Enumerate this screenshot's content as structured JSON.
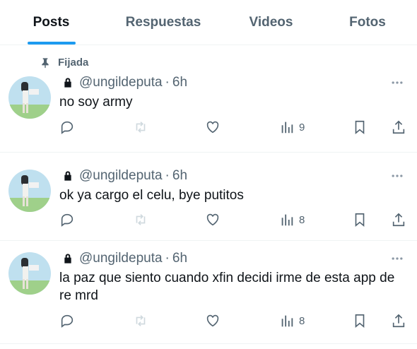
{
  "tabs": [
    {
      "label": "Posts",
      "active": true
    },
    {
      "label": "Respuestas",
      "active": false
    },
    {
      "label": "Videos",
      "active": false
    },
    {
      "label": "Fotos",
      "active": false
    }
  ],
  "pinned_label": "Fijada",
  "posts": [
    {
      "handle": "@ungildeputa",
      "separator": "·",
      "time": "6h",
      "text": "no soy army",
      "views": "9"
    },
    {
      "handle": "@ungildeputa",
      "separator": "·",
      "time": "6h",
      "text": "ok ya cargo el celu, bye putitos",
      "views": "8"
    },
    {
      "handle": "@ungildeputa",
      "separator": "·",
      "time": "6h",
      "text": "la paz que siento cuando xfin decidi irme de esta app de re mrd",
      "views": "8"
    }
  ],
  "colors": {
    "accent": "#1d9bf0",
    "secondary_text": "#536471",
    "primary_text": "#0f1419",
    "disabled_icon": "#cfd9de",
    "divider": "#eff3f4"
  },
  "icons": {
    "pin": "pin-icon",
    "lock": "lock-icon",
    "more": "more-icon",
    "reply": "reply-icon",
    "repost": "repost-icon",
    "like": "like-icon",
    "views": "views-icon",
    "bookmark": "bookmark-icon",
    "share": "share-icon"
  }
}
